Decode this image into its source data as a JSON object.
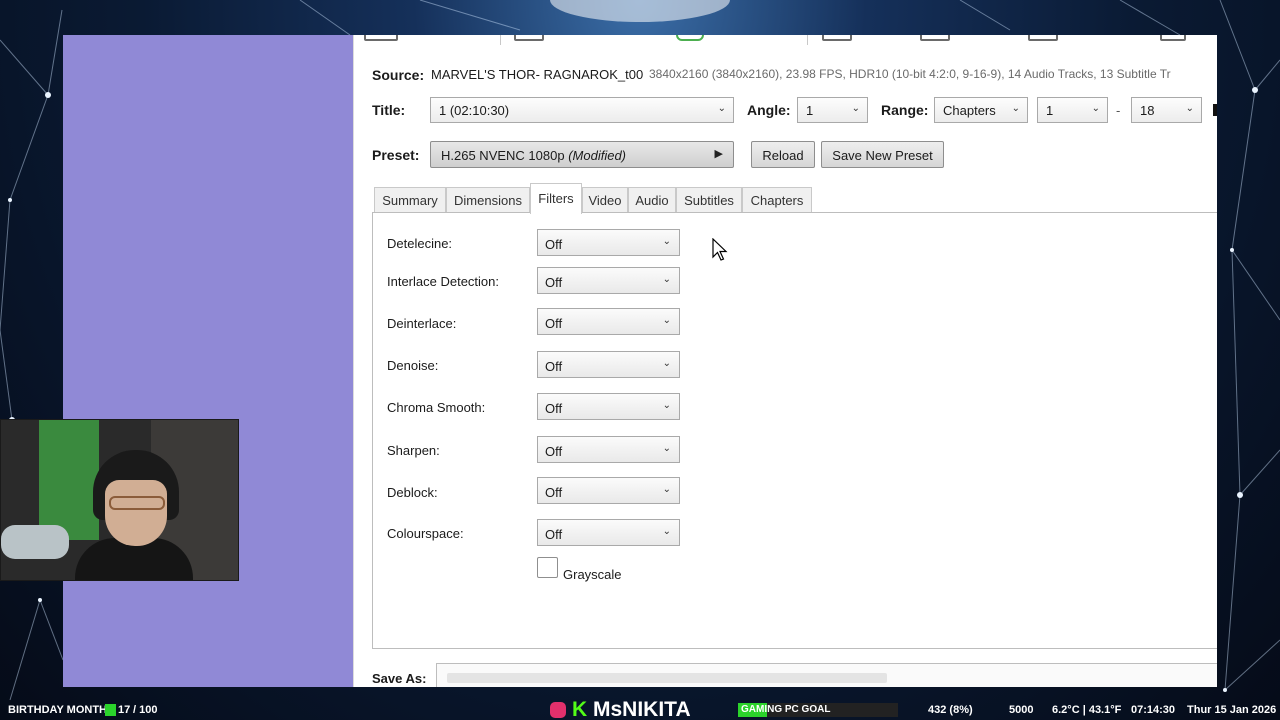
{
  "window": {
    "source_label": "Source:",
    "source_name": "MARVEL'S THOR- RAGNAROK_t00",
    "source_info": "3840x2160 (3840x2160), 23.98 FPS, HDR10 (10-bit 4:2:0, 9-16-9), 14 Audio Tracks, 13 Subtitle Tr"
  },
  "title_row": {
    "title_label": "Title:",
    "title_value": "1  (02:10:30)",
    "angle_label": "Angle:",
    "angle_value": "1",
    "range_label": "Range:",
    "range_mode": "Chapters",
    "range_start": "1",
    "range_sep": "-",
    "range_end": "18"
  },
  "preset_row": {
    "preset_label": "Preset:",
    "preset_name": "H.265 NVENC 1080p",
    "preset_modified": "(Modified)",
    "reload_label": "Reload",
    "save_new_preset_label": "Save New Preset"
  },
  "tabs": [
    "Summary",
    "Dimensions",
    "Filters",
    "Video",
    "Audio",
    "Subtitles",
    "Chapters"
  ],
  "active_tab": "Filters",
  "filters": [
    {
      "label": "Detelecine:",
      "value": "Off"
    },
    {
      "label": "Interlace Detection:",
      "value": "Off"
    },
    {
      "label": "Deinterlace:",
      "value": "Off"
    },
    {
      "label": "Denoise:",
      "value": "Off"
    },
    {
      "label": "Chroma Smooth:",
      "value": "Off"
    },
    {
      "label": "Sharpen:",
      "value": "Off"
    },
    {
      "label": "Deblock:",
      "value": "Off"
    },
    {
      "label": "Colourspace:",
      "value": "Off"
    }
  ],
  "grayscale": {
    "label": "Grayscale",
    "checked": false
  },
  "save_as": {
    "label": "Save As:"
  },
  "stream_overlay": {
    "birthday_label": "BIRTHDAY MONTH",
    "birthday_count": "17",
    "birthday_total": "/ 100",
    "channel_k": "K",
    "channel_name": "MsNIKITA",
    "goal_label": "GAMING PC GOAL",
    "goal_fraction": 0.18,
    "viewers": "432 (8%)",
    "count": "5000",
    "temperature": "6.2°C | 43.1°F",
    "time": "07:14:30",
    "date": "Thur 15 Jan 2026"
  },
  "colors": {
    "purple_panel": "#9089d6",
    "kick_green": "#53fc18",
    "instagram": "#e1306c"
  }
}
